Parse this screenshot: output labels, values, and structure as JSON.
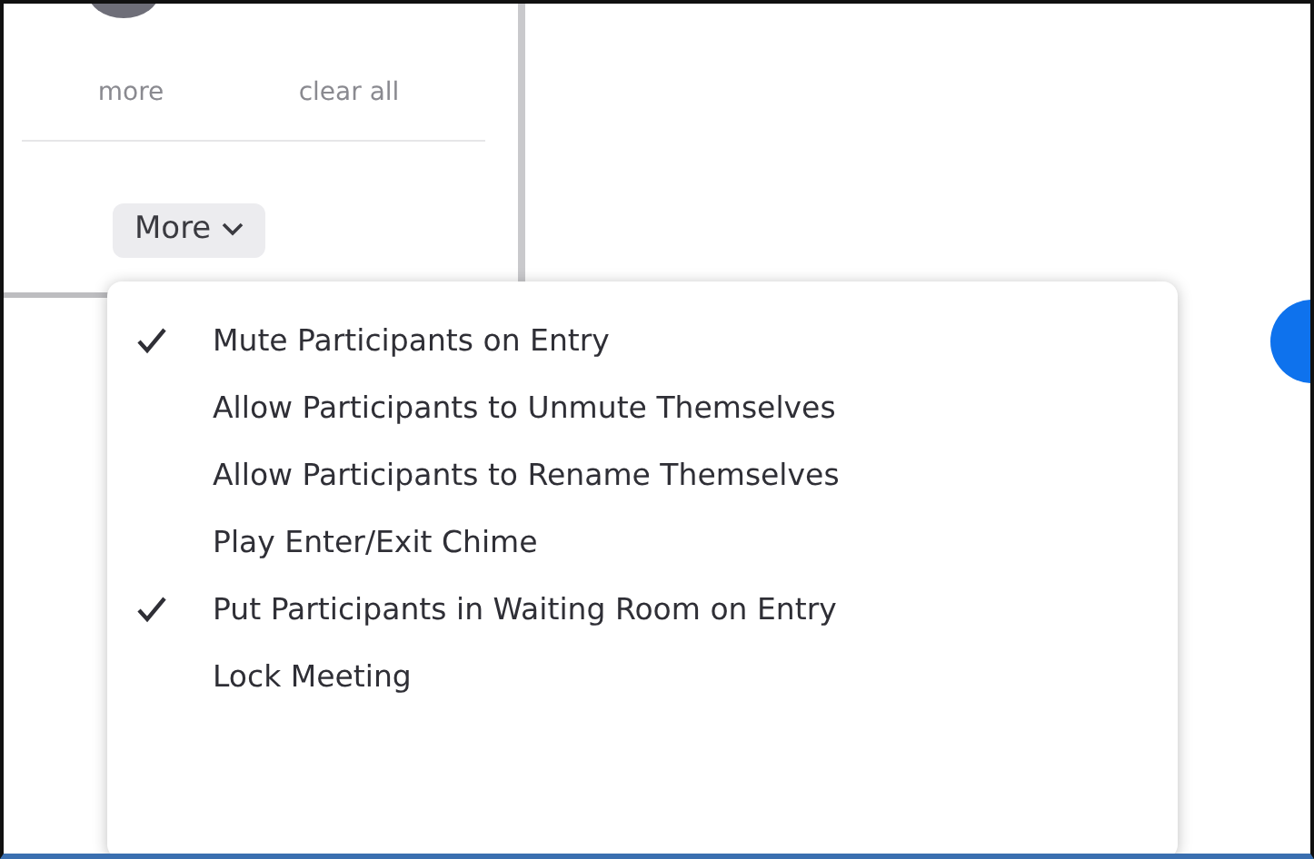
{
  "toolbar_actions": [
    {
      "label": "more"
    },
    {
      "label": "clear all"
    }
  ],
  "more_button": {
    "label": "More",
    "expanded": true
  },
  "menu": [
    {
      "label": "Mute Participants on Entry",
      "checked": true
    },
    {
      "label": "Allow Participants to Unmute Themselves",
      "checked": false
    },
    {
      "label": "Allow Participants to Rename Themselves",
      "checked": false
    },
    {
      "label": "Play Enter/Exit Chime",
      "checked": false
    },
    {
      "label": "Put Participants in Waiting Room on Entry",
      "checked": true
    },
    {
      "label": "Lock Meeting",
      "checked": false
    }
  ]
}
